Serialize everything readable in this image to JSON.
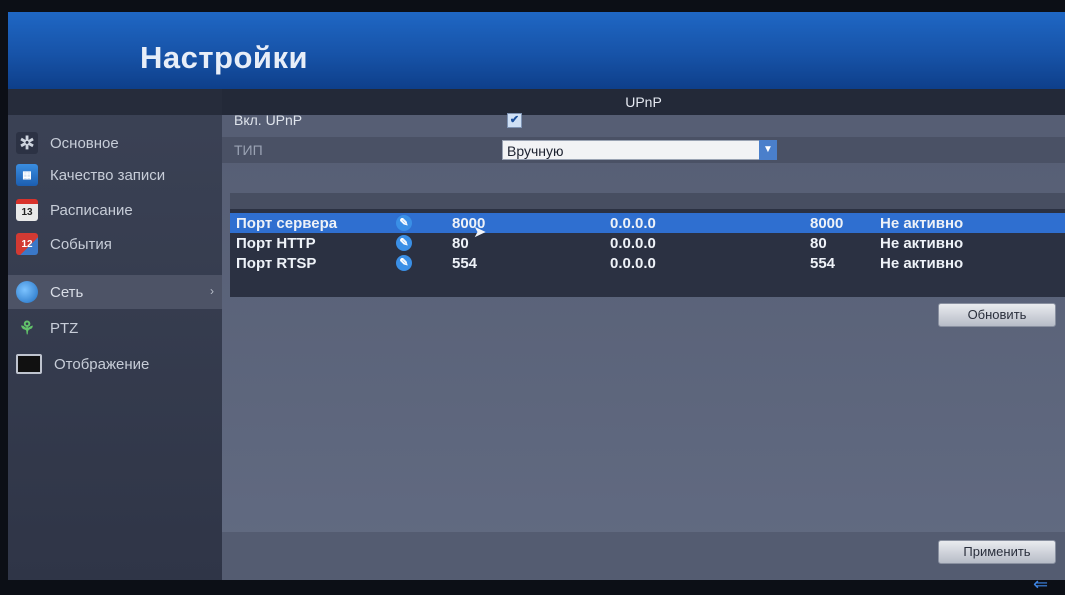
{
  "window": {
    "title": "Настройки"
  },
  "sidebar": {
    "items": [
      {
        "label": "Основное",
        "icon": "gear-icon"
      },
      {
        "label": "Качество записи",
        "icon": "film-icon"
      },
      {
        "label": "Расписание",
        "icon": "calendar-icon",
        "badge": "13"
      },
      {
        "label": "События",
        "icon": "events-flag-icon",
        "badge": "12"
      },
      {
        "label": "Сеть",
        "icon": "globe-icon",
        "active": true
      },
      {
        "label": "PTZ",
        "icon": "ptz-camera-icon"
      },
      {
        "label": "Отображение",
        "icon": "monitor-icon"
      }
    ]
  },
  "panel": {
    "title": "UPnP",
    "enable_label": "Вкл. UPnP",
    "enable_checked": true,
    "check_mark": "✔",
    "type_label": "ТИП",
    "type_value": "Вручную",
    "table": {
      "rows": [
        {
          "name": "Порт сервера",
          "port": "8000",
          "ip": "0.0.0.0",
          "ext": "8000",
          "status": "Не активно"
        },
        {
          "name": "Порт HTTP",
          "port": "80",
          "ip": "0.0.0.0",
          "ext": "80",
          "status": "Не активно"
        },
        {
          "name": "Порт RTSP",
          "port": "554",
          "ip": "0.0.0.0",
          "ext": "554",
          "status": "Не активно"
        }
      ]
    },
    "refresh_button": "Обновить",
    "apply_button": "Применить"
  },
  "colors": {
    "accent": "#2f6fd0",
    "banner": "#1f67c4"
  }
}
